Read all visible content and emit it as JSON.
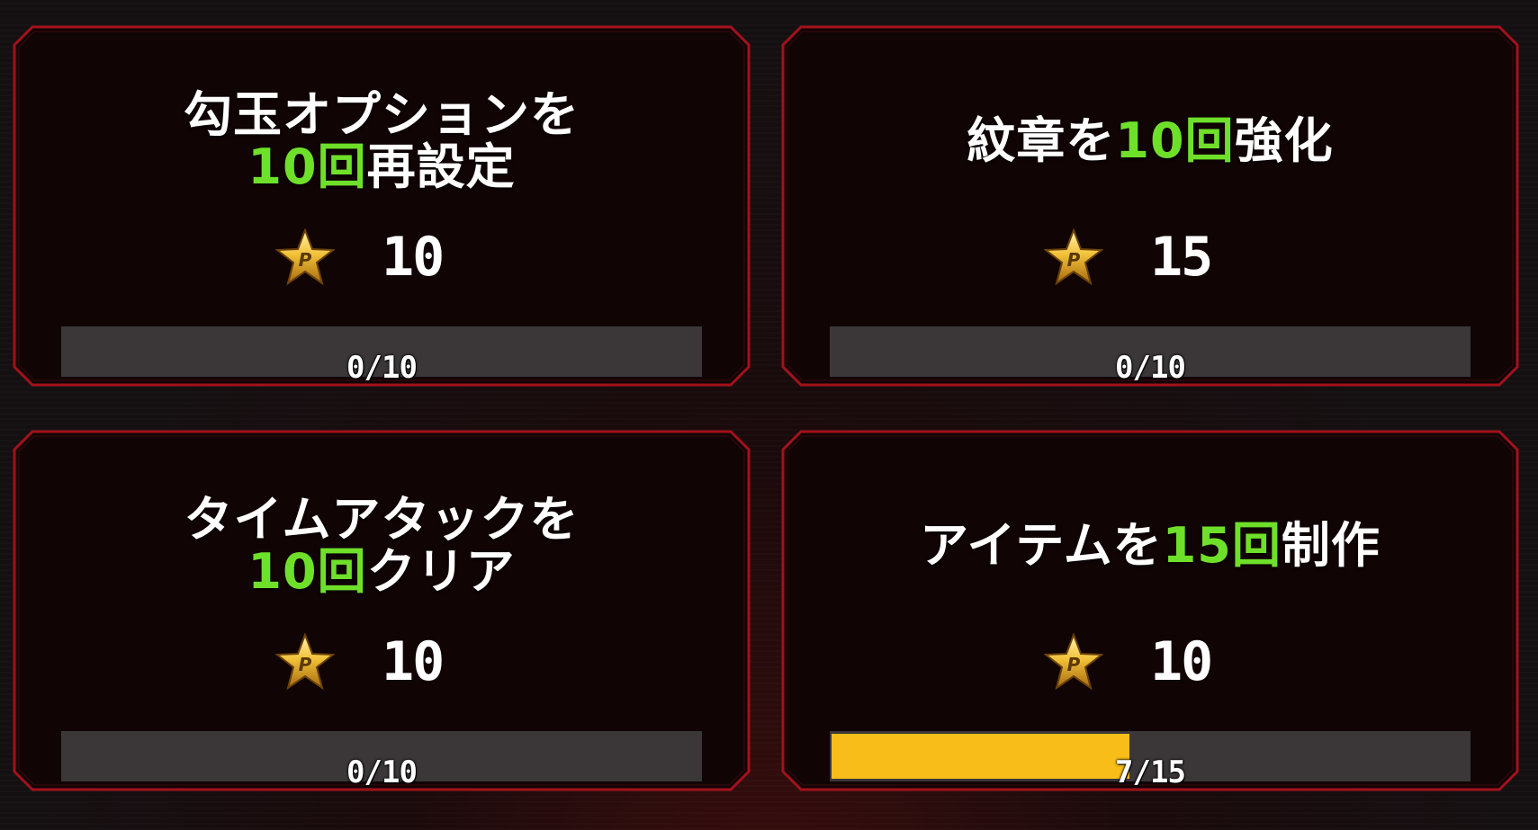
{
  "missions": [
    {
      "title_lines": [
        [
          "勾玉オプションを",
          ""
        ],
        [
          "",
          "10回"
        ],
        [
          "再設定",
          ""
        ]
      ],
      "pre": "勾玉オプションを",
      "hl": "10回",
      "post": "再設定",
      "reward_icon": "p-star-icon",
      "points": "10",
      "progress_text": "0/10",
      "progress": 0
    },
    {
      "pre": "紋章を",
      "hl": "10回",
      "post": "強化",
      "reward_icon": "p-star-icon",
      "points": "15",
      "progress_text": "0/10",
      "progress": 0
    },
    {
      "pre": "タイムアタックを",
      "hl": "10回",
      "post": "クリア",
      "reward_icon": "p-star-icon",
      "points": "10",
      "progress_text": "0/10",
      "progress": 0
    },
    {
      "pre": "アイテムを",
      "hl": "15回",
      "post": "制作",
      "reward_icon": "p-star-icon",
      "points": "10",
      "progress_text": "7/15",
      "progress": 0.467
    }
  ],
  "colors": {
    "highlight": "#6fe02a",
    "card_border": "#a3111a",
    "progress_fill": "#f8bd18",
    "progress_track": "#3b3739"
  }
}
